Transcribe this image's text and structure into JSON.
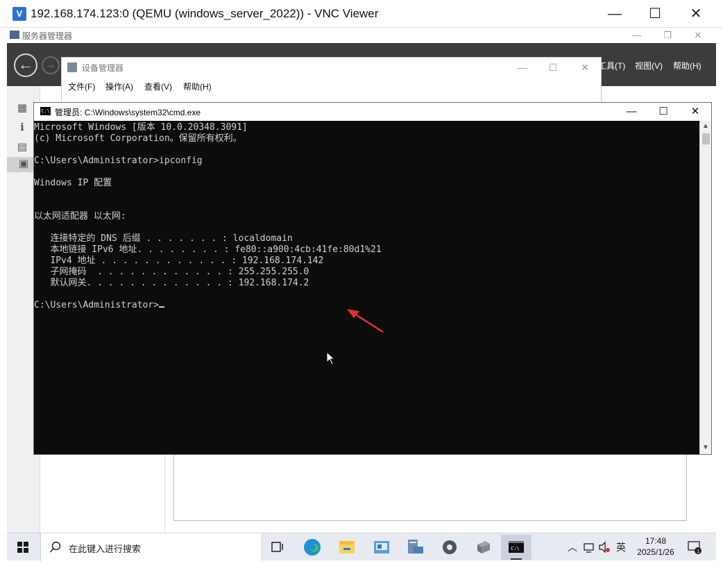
{
  "vnc": {
    "title": "192.168.174.123:0 (QEMU (windows_server_2022)) - VNC Viewer",
    "logo": "V",
    "minimize": "—",
    "maximize": "☐",
    "close": "✕"
  },
  "server_manager": {
    "title": "服务器管理器",
    "menus": [
      "工具(T)",
      "视图(V)",
      "帮助(H)"
    ]
  },
  "device_manager": {
    "title": "设备管理器",
    "menus": [
      "文件(F)",
      "操作(A)",
      "查看(V)",
      "帮助(H)"
    ]
  },
  "cmd": {
    "title": "管理员: C:\\Windows\\system32\\cmd.exe",
    "icon_text": "C:\\",
    "lines": [
      "Microsoft Windows [版本 10.0.20348.3091]",
      "(c) Microsoft Corporation。保留所有权利。",
      "",
      "C:\\Users\\Administrator>ipconfig",
      "",
      "Windows IP 配置",
      "",
      "",
      "以太网适配器 以太网:",
      "",
      "   连接特定的 DNS 后缀 . . . . . . . : localdomain",
      "   本地链接 IPv6 地址. . . . . . . . : fe80::a900:4cb:41fe:80d1%21",
      "   IPv4 地址 . . . . . . . . . . . . : 192.168.174.142",
      "   子网掩码  . . . . . . . . . . . . : 255.255.255.0",
      "   默认网关. . . . . . . . . . . . . : 192.168.174.2",
      "",
      "C:\\Users\\Administrator>"
    ]
  },
  "taskbar": {
    "search_placeholder": "在此键入进行搜索",
    "ime": "英",
    "time": "17:48",
    "date": "2025/1/26",
    "notification_count": "1",
    "icons": [
      "task-view-icon",
      "edge-icon",
      "file-explorer-icon",
      "control-panel-icon",
      "server-manager-icon",
      "settings-icon",
      "network-server-icon",
      "cmd-icon"
    ]
  }
}
